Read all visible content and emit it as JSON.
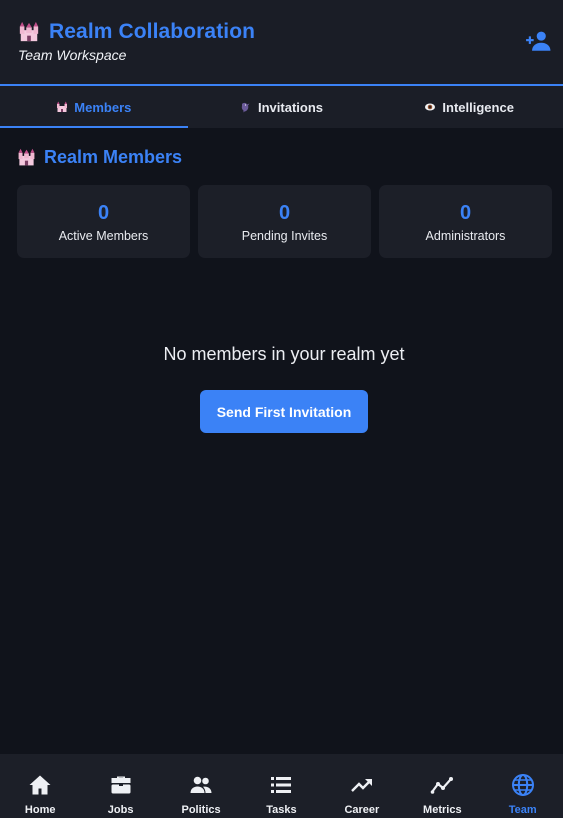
{
  "header": {
    "emoji": "castle",
    "title": "Realm Collaboration",
    "subtitle": "Team Workspace",
    "add_user_icon": "person-add-icon"
  },
  "colors": {
    "accent": "#3b82f6",
    "background": "#10131b",
    "surface": "#1c1f28",
    "header": "#1a1d26"
  },
  "tabs": [
    {
      "label": "Members",
      "icon": "castle-icon",
      "active": true
    },
    {
      "label": "Invitations",
      "icon": "raven-icon",
      "active": false
    },
    {
      "label": "Intelligence",
      "icon": "eye-icon",
      "active": false
    }
  ],
  "section": {
    "title": "Realm Members",
    "icon": "castle-icon"
  },
  "stats": [
    {
      "value": "0",
      "label": "Active Members"
    },
    {
      "value": "0",
      "label": "Pending Invites"
    },
    {
      "value": "0",
      "label": "Administrators"
    }
  ],
  "empty_state": {
    "message": "No members in your realm yet",
    "button_label": "Send First Invitation"
  },
  "bottom_nav": [
    {
      "label": "Home",
      "icon": "home-icon",
      "active": false
    },
    {
      "label": "Jobs",
      "icon": "briefcase-icon",
      "active": false
    },
    {
      "label": "Politics",
      "icon": "people-icon",
      "active": false
    },
    {
      "label": "Tasks",
      "icon": "list-icon",
      "active": false
    },
    {
      "label": "Career",
      "icon": "trending-up-icon",
      "active": false
    },
    {
      "label": "Metrics",
      "icon": "line-chart-icon",
      "active": false
    },
    {
      "label": "Team",
      "icon": "globe-icon",
      "active": true
    }
  ]
}
